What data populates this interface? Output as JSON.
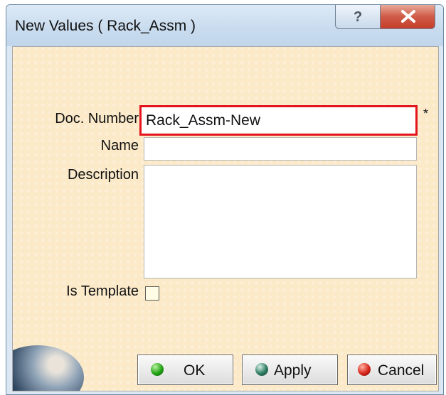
{
  "window": {
    "title": "New Values ( Rack_Assm )",
    "help_symbol": "?",
    "close_symbol": "X"
  },
  "form": {
    "doc_number": {
      "label": "Doc. Number",
      "value": "Rack_Assm-New",
      "required_marker": "*"
    },
    "name": {
      "label": "Name",
      "value": ""
    },
    "description": {
      "label": "Description",
      "value": ""
    },
    "is_template": {
      "label": "Is Template",
      "checked": false
    }
  },
  "buttons": {
    "ok": "OK",
    "apply": "Apply",
    "cancel": "Cancel"
  },
  "colors": {
    "panel_background": "#fbe9c8",
    "highlight_border": "#e2141c",
    "ok_icon": "#22a314",
    "apply_icon": "#2e7c63",
    "cancel_icon": "#d8261b"
  }
}
